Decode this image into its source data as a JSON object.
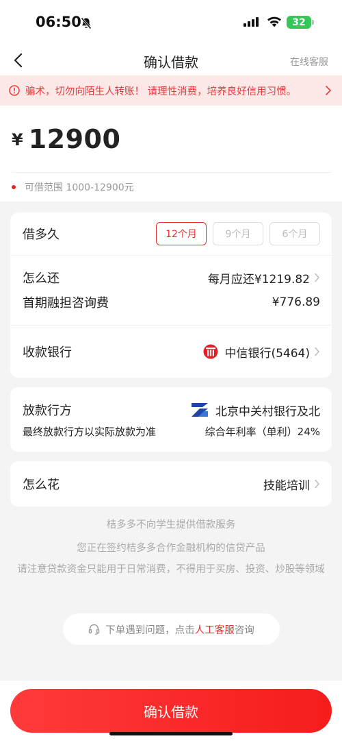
{
  "status_bar": {
    "time": "06:50",
    "battery": "32"
  },
  "nav": {
    "title": "确认借款",
    "service": "在线客服"
  },
  "warning": {
    "text": "骗术，切勿向陌生人转账！ 请理性消费，培养良好信用习惯。"
  },
  "amount": {
    "currency": "¥",
    "value": "12900",
    "range": "可借范围 1000-12900元"
  },
  "term": {
    "label": "借多久",
    "options": [
      "12个月",
      "9个月",
      "6个月"
    ],
    "selected": "12个月"
  },
  "repay": {
    "label": "怎么还",
    "value": "每月应还¥1219.82",
    "fee_label": "首期融担咨询费",
    "fee_value": "¥776.89"
  },
  "bank": {
    "label": "收款银行",
    "value": "中信银行(5464)"
  },
  "lender": {
    "label": "放款行方",
    "note": "最终放款行方以实际放款为准",
    "name": "北京中关村银行及北",
    "rate": "综合年利率（单利）24%"
  },
  "purpose": {
    "label": "怎么花",
    "value": "技能培训"
  },
  "notices": {
    "line1": "桔多多不向学生提供借款服务",
    "line2": "您正在签约桔多多合作金融机构的信贷产品",
    "line3": "请注意贷款资金只能用于日常消费，不得用于买房、投资、炒股等领域"
  },
  "help": {
    "prefix": "下单遇到问题，点击",
    "link": "人工客服",
    "suffix": "咨询"
  },
  "confirm_button": "确认借款",
  "colors": {
    "accent": "#e52e2e",
    "warning_bg": "#fde8e8",
    "battery": "#35c759"
  }
}
